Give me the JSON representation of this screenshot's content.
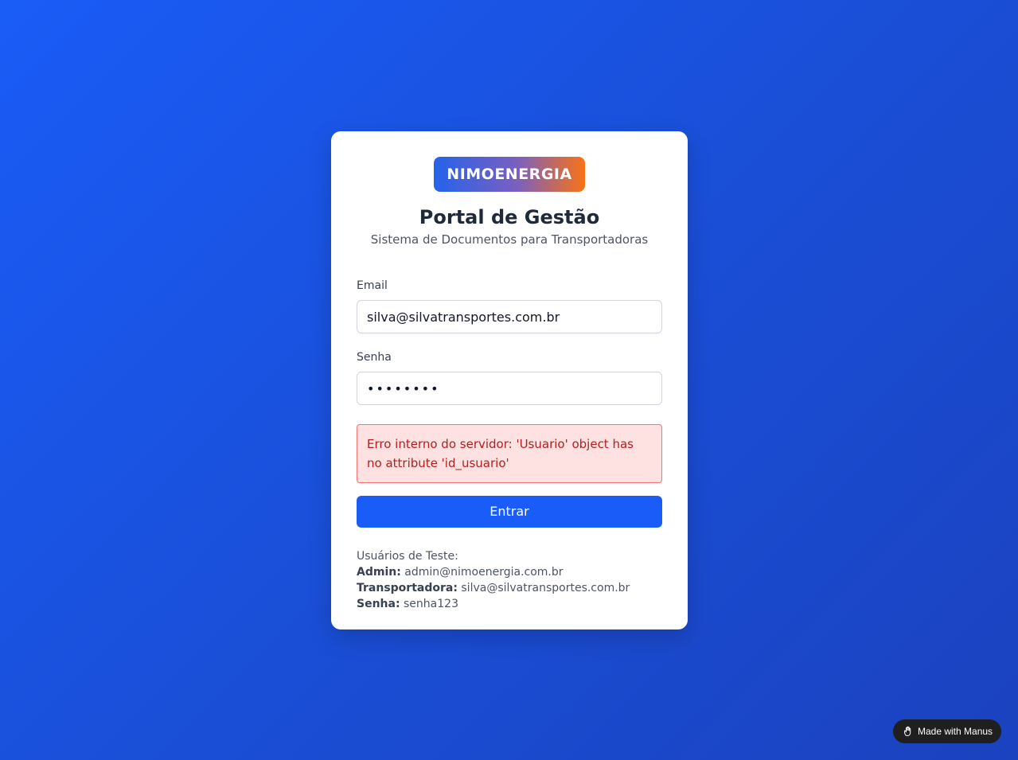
{
  "brand": {
    "logo_text": "NIMOENERGIA"
  },
  "header": {
    "title": "Portal de Gestão",
    "subtitle": "Sistema de Documentos para Transportadoras"
  },
  "form": {
    "email_label": "Email",
    "email_value": "silva@silvatransportes.com.br",
    "password_label": "Senha",
    "password_value": "••••••••",
    "error_message": "Erro interno do servidor: 'Usuario' object has no attribute 'id_usuario'",
    "submit_label": "Entrar"
  },
  "test_users": {
    "heading": "Usuários de Teste:",
    "admin_label": "Admin:",
    "admin_value": "admin@nimoenergia.com.br",
    "transportadora_label": "Transportadora:",
    "transportadora_value": "silva@silvatransportes.com.br",
    "senha_label": "Senha:",
    "senha_value": "senha123"
  },
  "badge": {
    "label": "Made with Manus",
    "icon": "manus-hand-icon"
  },
  "colors": {
    "background": "#1a5cf7",
    "primary_button": "#1a5cf7",
    "error_bg": "#fee2e2",
    "error_text": "#b91c1c",
    "logo_gradient_start": "#2563eb",
    "logo_gradient_end": "#f97316"
  }
}
